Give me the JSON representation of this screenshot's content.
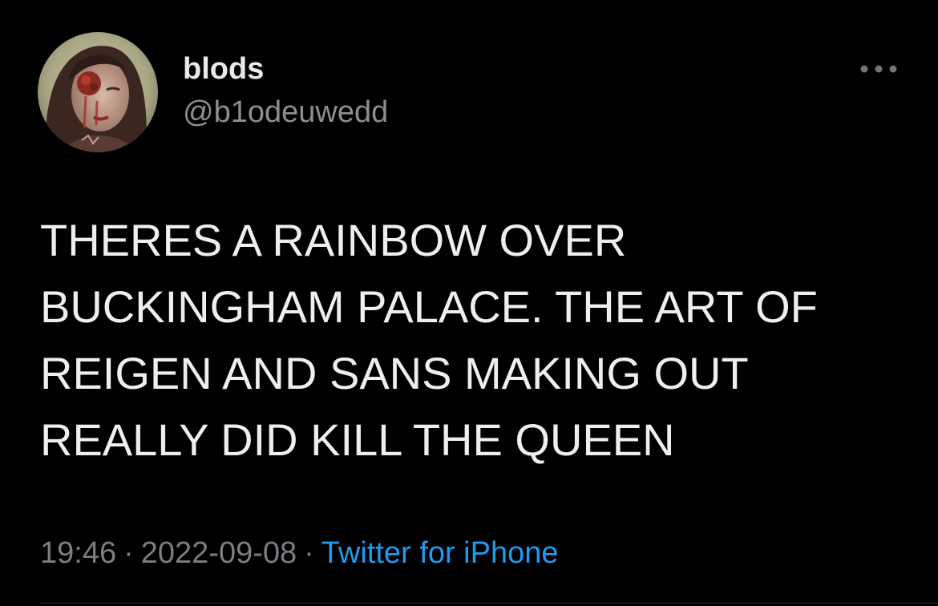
{
  "tweet": {
    "author": {
      "display_name": "blods",
      "handle": "@b1odeuwedd",
      "avatar_icon": "profile-avatar"
    },
    "text": "THERES A RAINBOW OVER\nBUCKINGHAM PALACE. THE ART OF\nREIGEN AND SANS MAKING OUT\nREALLY DID KILL THE QUEEN",
    "meta": {
      "time": "19:46",
      "separator": "·",
      "date": "2022-09-08",
      "source": "Twitter for iPhone"
    },
    "more_icon": "more-horizontal-icon"
  },
  "colors": {
    "background": "#000000",
    "text_primary": "#e7e9ea",
    "text_secondary": "#7a7e83",
    "link": "#1d9bf0",
    "divider": "#2f3336"
  }
}
